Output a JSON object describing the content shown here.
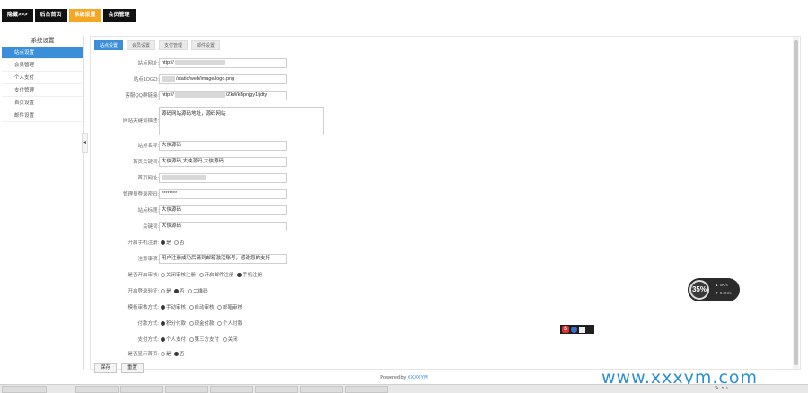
{
  "topnav": {
    "items": [
      {
        "label": "隐藏>>>",
        "active": false
      },
      {
        "label": "后台首页",
        "active": false
      },
      {
        "label": "系统设置",
        "active": true
      },
      {
        "label": "会员管理",
        "active": false
      }
    ]
  },
  "sidebar": {
    "title": "系统设置",
    "items": [
      {
        "label": "站点设置",
        "active": true
      },
      {
        "label": "会员管理",
        "active": false
      },
      {
        "label": "个人支付",
        "active": false
      },
      {
        "label": "支付管理",
        "active": false
      },
      {
        "label": "首页设置",
        "active": false
      },
      {
        "label": "邮件设置",
        "active": false
      }
    ]
  },
  "tabs": [
    {
      "label": "站点设置",
      "active": true
    },
    {
      "label": "会员设置",
      "active": false
    },
    {
      "label": "支付管理",
      "active": false
    },
    {
      "label": "邮件设置",
      "active": false
    }
  ],
  "form": {
    "site_url": {
      "label": "站点网址:",
      "value": "http://"
    },
    "logo": {
      "label": "站点LOGO:",
      "value": "/static/web/image/logo.png"
    },
    "qq_link": {
      "label": "客服QQ群链接:",
      "value": "http://",
      "value_tail": "/ZkWkBpnjgy1fjdty"
    },
    "description": {
      "label": "网站关键词描述:",
      "value": "源码网站源码地址，源码网站"
    },
    "site_name": {
      "label": "站点名称:",
      "value": "大侠源码"
    },
    "keywords": {
      "label": "首页关键词:",
      "value": "大侠源码,大侠源码,大侠源码"
    },
    "site_addr": {
      "label": "首页网址:",
      "value": ""
    },
    "admin_pwd": {
      "label": "管理员登录密码:",
      "value": "********"
    },
    "site_title": {
      "label": "站点标题:",
      "value": "大侠源码"
    },
    "copyright": {
      "label": "关键词:",
      "value": "大侠源码"
    },
    "open_register": {
      "label": "开启手机注册:",
      "options": [
        {
          "label": "是",
          "on": true
        },
        {
          "label": "否",
          "on": false
        }
      ]
    },
    "notice": {
      "label": "注意事项:",
      "value": "用户注册成功后请到邮箱激活账号，感谢您的支持"
    },
    "member_mode": {
      "label": "是否开启审核:",
      "options": [
        {
          "label": "关闭审核注册",
          "on": false
        },
        {
          "label": "开启邮件注册",
          "on": false
        },
        {
          "label": "手机注册",
          "on": true
        }
      ]
    },
    "enable_captcha": {
      "label": "开启登录验证:",
      "options": [
        {
          "label": "是",
          "on": false
        },
        {
          "label": "否",
          "on": true
        },
        {
          "label": "二维码",
          "on": false
        }
      ]
    },
    "audit_method": {
      "label": "模板审核方式:",
      "options": [
        {
          "label": "手动审核",
          "on": true
        },
        {
          "label": "自动审核",
          "on": false
        },
        {
          "label": "邮箱审核",
          "on": false
        }
      ]
    },
    "pay_method": {
      "label": "付款方式:",
      "options": [
        {
          "label": "积分付款",
          "on": true
        },
        {
          "label": "现金付款",
          "on": false
        },
        {
          "label": "个人付款",
          "on": false
        }
      ]
    },
    "pay_channel": {
      "label": "支付方式:",
      "options": [
        {
          "label": "个人支付",
          "on": true
        },
        {
          "label": "第三方支付",
          "on": false
        },
        {
          "label": "关闭",
          "on": false
        }
      ]
    },
    "show_ads": {
      "label": "是否显示首页:",
      "options": [
        {
          "label": "是",
          "on": false
        },
        {
          "label": "否",
          "on": true
        }
      ]
    }
  },
  "buttons": {
    "submit": "保存",
    "reset": "重置"
  },
  "footer": {
    "prefix": "Powered by ",
    "link": "XXXXYM"
  },
  "watermark": "www.xxxym.com",
  "speed_widget": {
    "percent": "35%",
    "up": "0K/s",
    "down": "0.3K/s"
  },
  "colors": {
    "accent": "#3b8ed8",
    "active_nav": "#f5a623",
    "nav_bg": "#111111"
  }
}
